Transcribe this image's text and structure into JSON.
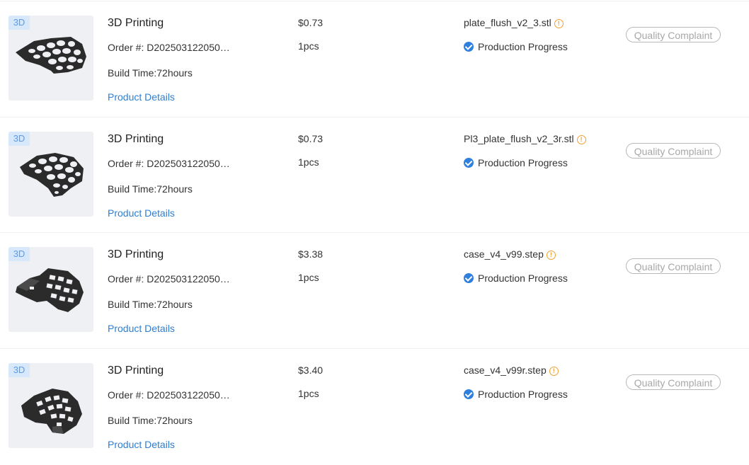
{
  "orders": [
    {
      "tag": "3D",
      "title": "3D Printing",
      "order_number": "Order #: D202503122050…",
      "build_time": "Build Time:72hours",
      "details_label": "Product Details",
      "price": "$0.73",
      "quantity": "1pcs",
      "file_name": "plate_flush_v2_3.stl",
      "warn_glyph": "!",
      "progress_label": "Production Progress",
      "complaint_label": "Quality Complaint"
    },
    {
      "tag": "3D",
      "title": "3D Printing",
      "order_number": "Order #: D202503122050…",
      "build_time": "Build Time:72hours",
      "details_label": "Product Details",
      "price": "$0.73",
      "quantity": "1pcs",
      "file_name": "Pl3_plate_flush_v2_3r.stl",
      "warn_glyph": "!",
      "progress_label": "Production Progress",
      "complaint_label": "Quality Complaint"
    },
    {
      "tag": "3D",
      "title": "3D Printing",
      "order_number": "Order #: D202503122050…",
      "build_time": "Build Time:72hours",
      "details_label": "Product Details",
      "price": "$3.38",
      "quantity": "1pcs",
      "file_name": "case_v4_v99.step",
      "warn_glyph": "!",
      "progress_label": "Production Progress",
      "complaint_label": "Quality Complaint"
    },
    {
      "tag": "3D",
      "title": "3D Printing",
      "order_number": "Order #: D202503122050…",
      "build_time": "Build Time:72hours",
      "details_label": "Product Details",
      "price": "$3.40",
      "quantity": "1pcs",
      "file_name": "case_v4_v99r.step",
      "warn_glyph": "!",
      "progress_label": "Production Progress",
      "complaint_label": "Quality Complaint"
    }
  ],
  "icons": {
    "warning": "warning-circle-icon",
    "progress": "check-circle-icon"
  },
  "colors": {
    "link": "#2a7fd6",
    "tag_bg": "#d7e8fb",
    "tag_text": "#5d9be6",
    "warning": "#f0a030",
    "check": "#2f80de",
    "model": "#2b2b2b",
    "thumb_bg": "#eef0f4"
  }
}
